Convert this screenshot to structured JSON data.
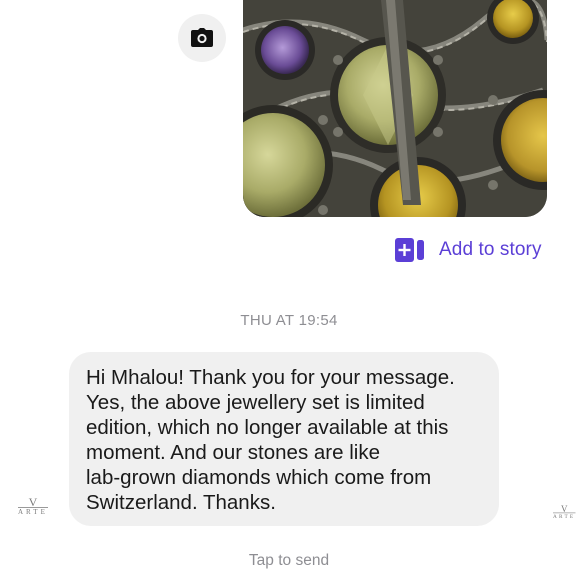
{
  "thread": {
    "camera_icon": "camera-icon",
    "photo_description_icon": "jewellery-photo",
    "add_to_story": {
      "icon": "add-to-story-icon",
      "label": "Add to story",
      "accent_color": "#5b3fd6"
    },
    "timestamp": "THU AT 19:54",
    "message": {
      "text": "Hi Mhalou! Thank you for your message.\nYes, the above jewellery set is limited\nedition, which no longer available at this\nmoment. And our stones are like\nlab-grown diamonds which come from\nSwitzerland. Thanks."
    },
    "watermark": {
      "mark": "V",
      "word": "ARTE"
    },
    "footer": {
      "tap_to_send": "Tap to send"
    }
  }
}
